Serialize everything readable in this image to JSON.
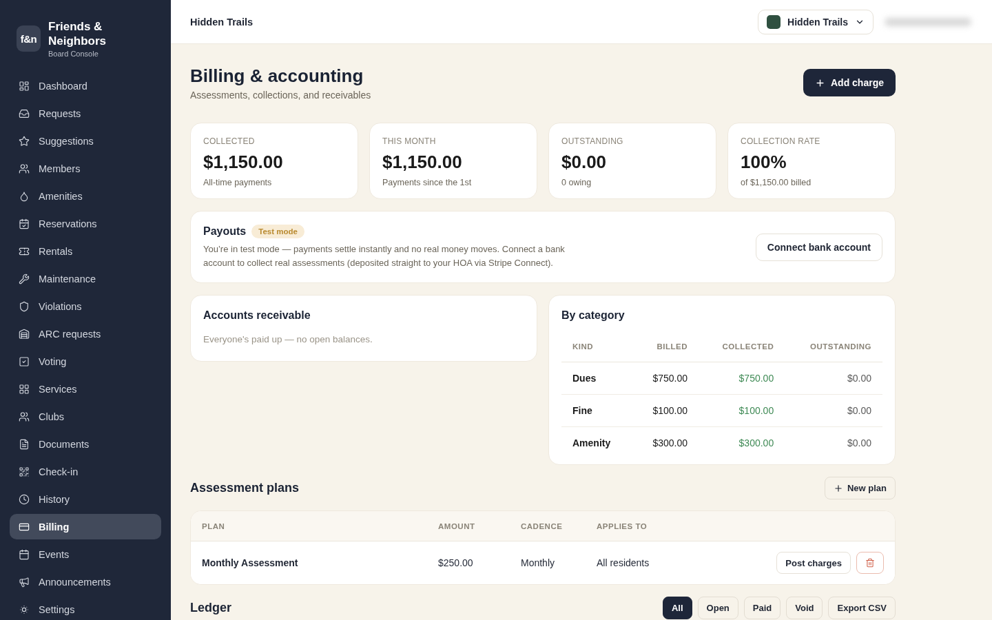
{
  "sidebar": {
    "brand": {
      "logo": "f&n",
      "name": "Friends & Neighbors",
      "subtitle": "Board Console"
    },
    "items": [
      {
        "label": "Dashboard",
        "selected": false
      },
      {
        "label": "Requests",
        "selected": false
      },
      {
        "label": "Suggestions",
        "selected": false
      },
      {
        "label": "Members",
        "selected": false
      },
      {
        "label": "Amenities",
        "selected": false
      },
      {
        "label": "Reservations",
        "selected": false
      },
      {
        "label": "Rentals",
        "selected": false
      },
      {
        "label": "Maintenance",
        "selected": false
      },
      {
        "label": "Violations",
        "selected": false
      },
      {
        "label": "ARC requests",
        "selected": false
      },
      {
        "label": "Voting",
        "selected": false
      },
      {
        "label": "Services",
        "selected": false
      },
      {
        "label": "Clubs",
        "selected": false
      },
      {
        "label": "Documents",
        "selected": false
      },
      {
        "label": "Check-in",
        "selected": false
      },
      {
        "label": "History",
        "selected": false
      },
      {
        "label": "Billing",
        "selected": true
      },
      {
        "label": "Events",
        "selected": false
      },
      {
        "label": "Announcements",
        "selected": false
      },
      {
        "label": "Settings",
        "selected": false
      }
    ]
  },
  "topbar": {
    "title": "Hidden Trails",
    "community_switcher": "Hidden Trails"
  },
  "header": {
    "title": "Billing & accounting",
    "subtitle": "Assessments, collections, and receivables",
    "action": "Add charge"
  },
  "stats": [
    {
      "label": "COLLECTED",
      "value": "$1,150.00",
      "note": "All-time payments"
    },
    {
      "label": "THIS MONTH",
      "value": "$1,150.00",
      "note": "Payments since the 1st"
    },
    {
      "label": "OUTSTANDING",
      "value": "$0.00",
      "note": "0 owing"
    },
    {
      "label": "COLLECTION RATE",
      "value": "100%",
      "note": "of $1,150.00 billed"
    }
  ],
  "payouts": {
    "title": "Payouts",
    "badge": "Test mode",
    "text": "You’re in test mode — payments settle instantly and no real money moves. Connect a bank account to collect real assessments (deposited straight to your HOA via Stripe Connect).",
    "action": "Connect bank account"
  },
  "accounts_receivable": {
    "title": "Accounts receivable",
    "empty_message": "Everyone's paid up — no open balances."
  },
  "by_category": {
    "title": "By category",
    "columns": [
      "KIND",
      "BILLED",
      "COLLECTED",
      "OUTSTANDING"
    ],
    "rows": [
      {
        "kind": "Dues",
        "billed": "$750.00",
        "collected": "$750.00",
        "outstanding": "$0.00"
      },
      {
        "kind": "Fine",
        "billed": "$100.00",
        "collected": "$100.00",
        "outstanding": "$0.00"
      },
      {
        "kind": "Amenity",
        "billed": "$300.00",
        "collected": "$300.00",
        "outstanding": "$0.00"
      }
    ]
  },
  "assessment_plans": {
    "title": "Assessment plans",
    "action": "New plan",
    "columns": [
      "PLAN",
      "AMOUNT",
      "CADENCE",
      "APPLIES TO"
    ],
    "rows": [
      {
        "plan": "Monthly Assessment",
        "amount": "$250.00",
        "cadence": "Monthly",
        "applies_to": "All residents",
        "action": "Post charges"
      }
    ]
  },
  "ledger": {
    "title": "Ledger",
    "filters": [
      {
        "label": "All",
        "selected": true
      },
      {
        "label": "Open",
        "selected": false
      },
      {
        "label": "Paid",
        "selected": false
      },
      {
        "label": "Void",
        "selected": false
      }
    ],
    "action": "Export CSV"
  }
}
